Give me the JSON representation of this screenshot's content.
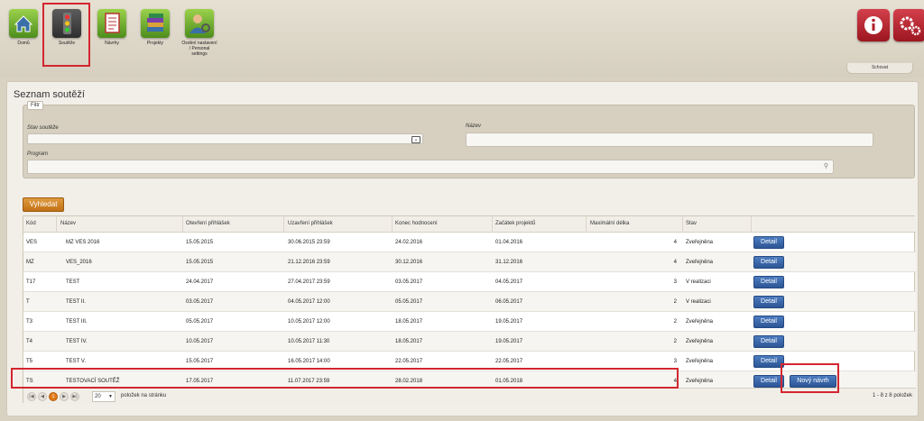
{
  "nav": {
    "items": [
      {
        "label": "Domů",
        "icon": "home-icon"
      },
      {
        "label": "Soutěže",
        "icon": "traffic-light-icon"
      },
      {
        "label": "Návrhy",
        "icon": "document-icon"
      },
      {
        "label": "Projekty",
        "icon": "books-icon"
      },
      {
        "label": "Osobní nastavení / Personal settings",
        "icon": "user-settings-icon"
      }
    ],
    "hide_label": "Schovat",
    "info_icon": "info-icon",
    "settings_icon": "gears-icon"
  },
  "page": {
    "title": "Seznam soutěží"
  },
  "filter": {
    "legend": "Filtr",
    "status_label": "Stav soutěže",
    "status_value": "",
    "name_label": "Název",
    "name_value": "",
    "program_label": "Program",
    "program_value": "",
    "search_label": "Vyhledat"
  },
  "table": {
    "columns": [
      "Kód",
      "Název",
      "Otevření přihlášek",
      "Uzavření přihlášek",
      "Konec hodnocení",
      "Začátek projektů",
      "Maximální délka",
      "Stav"
    ],
    "rows": [
      {
        "code": "VES",
        "name": "MZ VES 2016",
        "open": "15.05.2015",
        "close": "30.06.2015 23:59",
        "eval_end": "24.02.2016",
        "start": "01.04.2016",
        "max_len": "4",
        "status": "Zveřejněna",
        "detail": "Detail"
      },
      {
        "code": "MZ",
        "name": "VES_2016",
        "open": "15.05.2015",
        "close": "21.12.2016 23:59",
        "eval_end": "30.12.2016",
        "start": "31.12.2016",
        "max_len": "4",
        "status": "Zveřejněna",
        "detail": "Detail"
      },
      {
        "code": "T17",
        "name": "TEST",
        "open": "24.04.2017",
        "close": "27.04.2017 23:59",
        "eval_end": "03.05.2017",
        "start": "04.05.2017",
        "max_len": "3",
        "status": "V realizaci",
        "detail": "Detail"
      },
      {
        "code": "T",
        "name": "TEST II.",
        "open": "03.05.2017",
        "close": "04.05.2017 12:00",
        "eval_end": "05.05.2017",
        "start": "06.05.2017",
        "max_len": "2",
        "status": "V realizaci",
        "detail": "Detail"
      },
      {
        "code": "T3",
        "name": "TEST III.",
        "open": "05.05.2017",
        "close": "10.05.2017 12:00",
        "eval_end": "18.05.2017",
        "start": "19.05.2017",
        "max_len": "2",
        "status": "Zveřejněna",
        "detail": "Detail"
      },
      {
        "code": "T4",
        "name": "TEST IV.",
        "open": "10.05.2017",
        "close": "10.05.2017 11:30",
        "eval_end": "18.05.2017",
        "start": "19.05.2017",
        "max_len": "2",
        "status": "Zveřejněna",
        "detail": "Detail"
      },
      {
        "code": "T5",
        "name": "TEST V.",
        "open": "15.05.2017",
        "close": "16.05.2017 14:00",
        "eval_end": "22.05.2017",
        "start": "22.05.2017",
        "max_len": "3",
        "status": "Zveřejněna",
        "detail": "Detail"
      },
      {
        "code": "TS",
        "name": "TESTOVACÍ SOUTĚŽ",
        "open": "17.05.2017",
        "close": "11.07.2017 23:59",
        "eval_end": "28.02.2018",
        "start": "01.05.2018",
        "max_len": "4",
        "status": "Zveřejněna",
        "detail": "Detail",
        "new_proposal": "Nový návrh"
      }
    ]
  },
  "pager": {
    "current_page": "1",
    "page_size": "20",
    "page_size_label": "položek na stránku",
    "summary": "1 - 8 z 8 položek"
  }
}
